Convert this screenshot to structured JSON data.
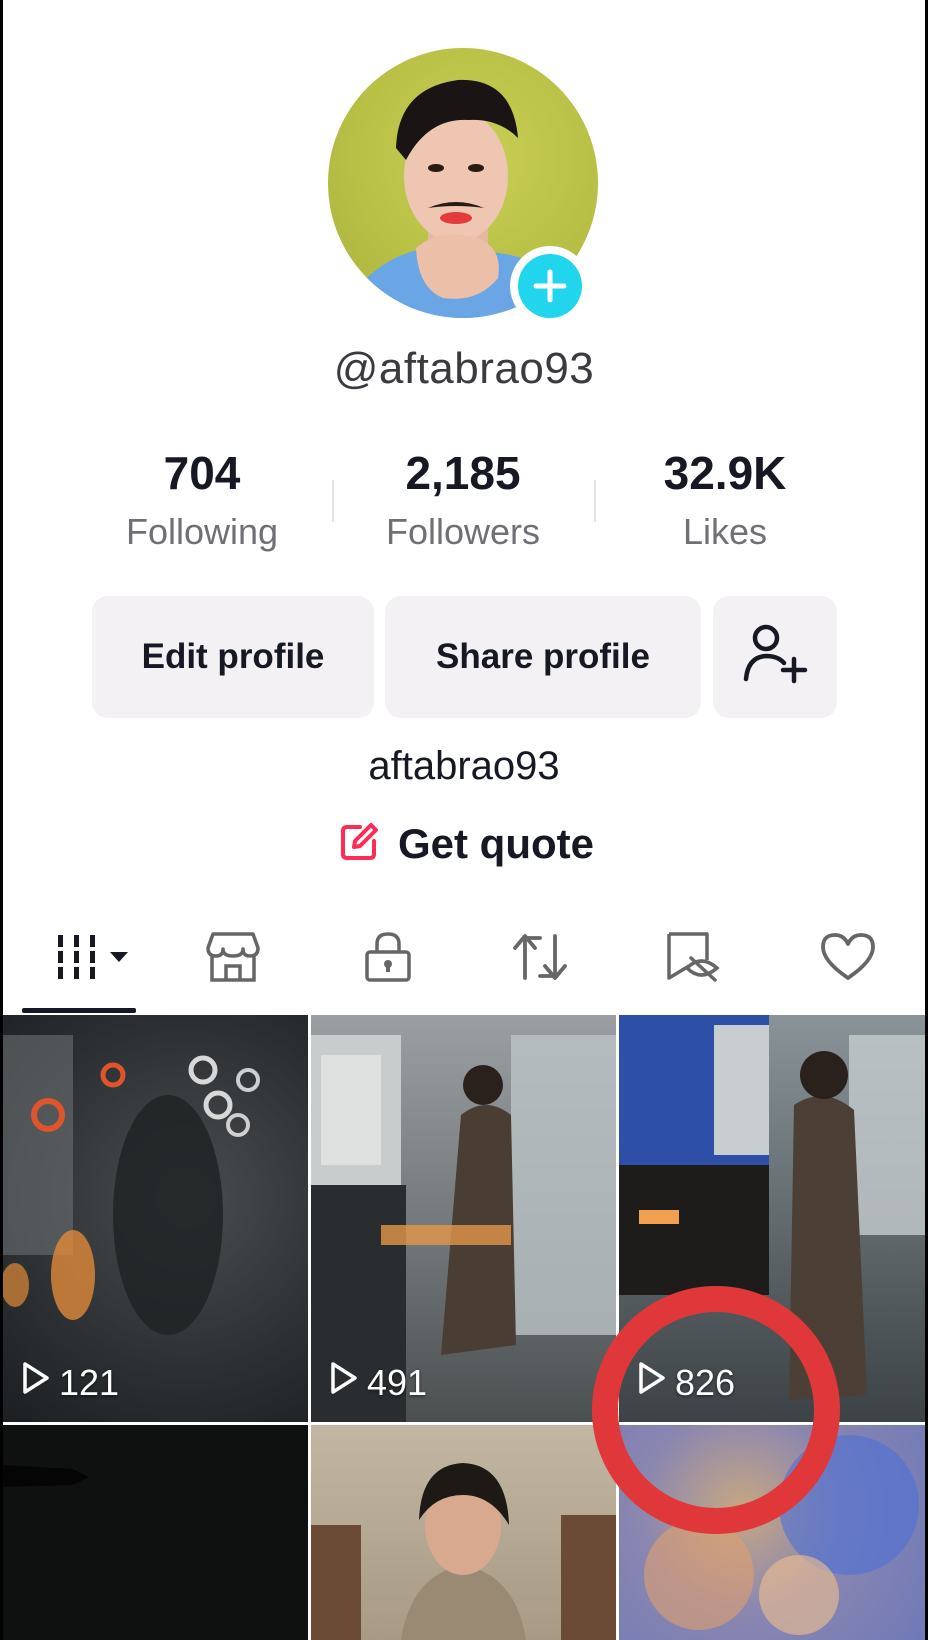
{
  "profile": {
    "handle": "@aftabrao93",
    "bio_name": "aftabrao93",
    "quote_label": "Get quote"
  },
  "stats": [
    {
      "value": "704",
      "label": "Following"
    },
    {
      "value": "2,185",
      "label": "Followers"
    },
    {
      "value": "32.9K",
      "label": "Likes"
    }
  ],
  "buttons": {
    "edit": "Edit profile",
    "share": "Share profile"
  },
  "tabs": [
    "videos-grid-icon",
    "shop-icon",
    "lock-icon",
    "repost-icon",
    "favorites-hidden-icon",
    "heart-icon"
  ],
  "videos": [
    {
      "views": "121"
    },
    {
      "views": "491"
    },
    {
      "views": "826"
    },
    {
      "views": ""
    },
    {
      "views": ""
    },
    {
      "views": ""
    }
  ],
  "colors": {
    "accent_cyan": "#20d5ec",
    "accent_pink": "#fe2c55",
    "annotation_red": "#e0383a"
  }
}
